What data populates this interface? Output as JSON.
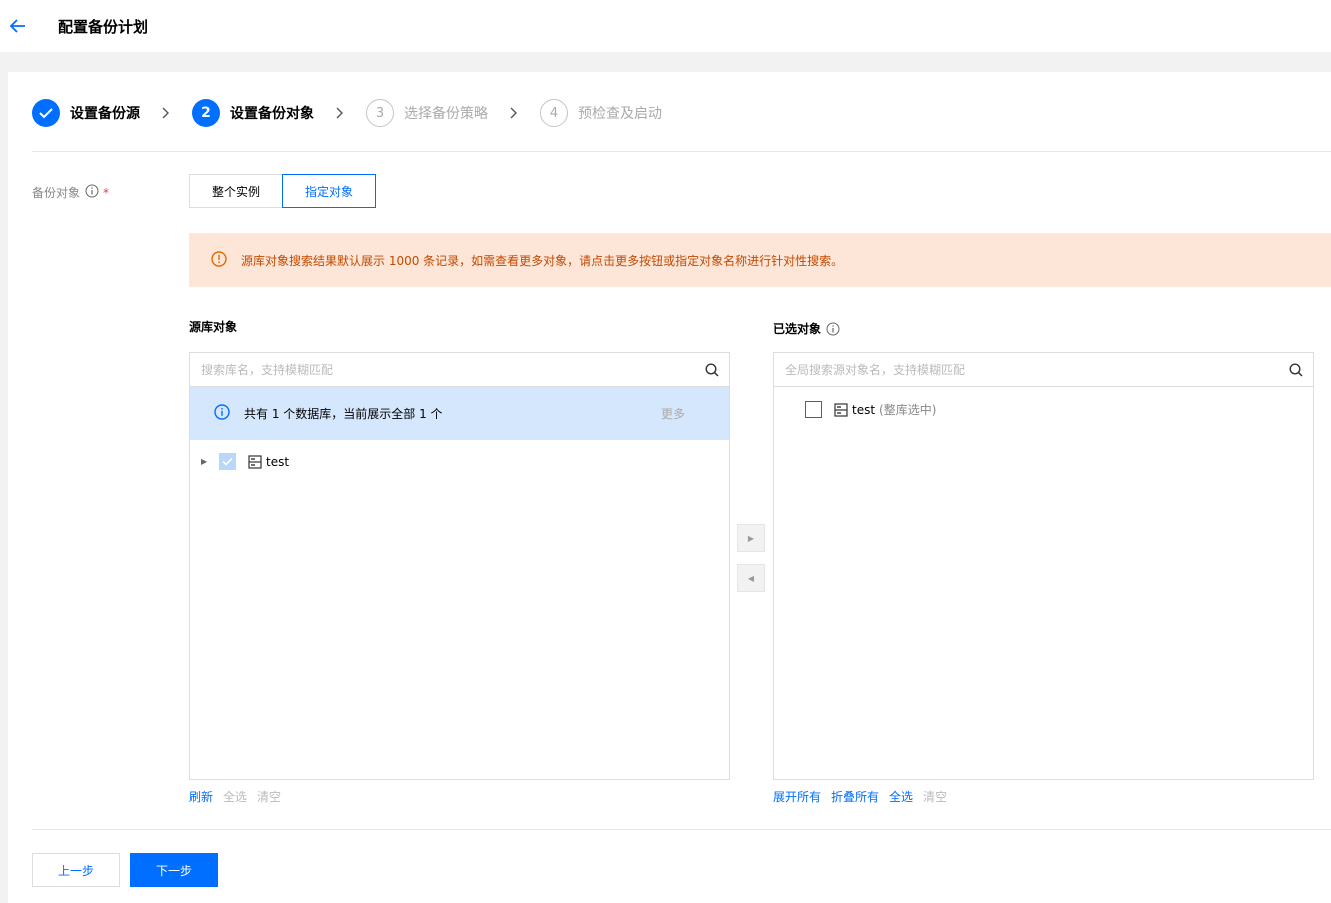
{
  "header": {
    "title": "配置备份计划"
  },
  "steps": [
    {
      "index": "",
      "label": "设置备份源",
      "status": "done"
    },
    {
      "index": "2",
      "label": "设置备份对象",
      "status": "active"
    },
    {
      "index": "3",
      "label": "选择备份策略",
      "status": "todo"
    },
    {
      "index": "4",
      "label": "预检查及启动",
      "status": "todo"
    }
  ],
  "form": {
    "backup_object_label": "备份对象",
    "required_mark": "*",
    "segment": {
      "options": [
        "整个实例",
        "指定对象"
      ],
      "selected": "指定对象"
    }
  },
  "alert": {
    "text": "源库对象搜索结果默认展示 1000 条记录，如需查看更多对象，请点击更多按钮或指定对象名称进行针对性搜索。"
  },
  "source": {
    "title": "源库对象",
    "search_placeholder": "搜索库名，支持模糊匹配",
    "info_text": "共有 1 个数据库，当前展示全部 1 个",
    "more_label": "更多",
    "tree": [
      {
        "label": "test",
        "checked": true
      }
    ],
    "actions": {
      "refresh": "刷新",
      "select_all": "全选",
      "clear": "清空"
    }
  },
  "selected": {
    "title": "已选对象",
    "search_placeholder": "全局搜索源对象名，支持模糊匹配",
    "items": [
      {
        "label": "test",
        "hint": "(整库选中)",
        "checked": false
      }
    ],
    "actions": {
      "expand_all": "展开所有",
      "collapse_all": "折叠所有",
      "select_all": "全选",
      "clear": "清空"
    }
  },
  "buttons": {
    "prev": "上一步",
    "next": "下一步"
  },
  "colors": {
    "primary": "#006eff",
    "alert_bg": "#fde5d7",
    "info_bg": "#d5e7fd"
  }
}
